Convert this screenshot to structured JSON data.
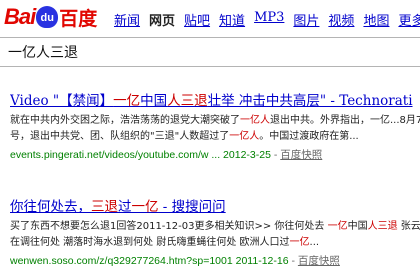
{
  "logo": {
    "text_bai": "Bai",
    "paw": "du",
    "text_cn": "百度"
  },
  "nav": [
    "新闻",
    "网页",
    "贴吧",
    "知道",
    "MP3",
    "图片",
    "视频",
    "地图",
    "更多»"
  ],
  "nav_active": "网页",
  "search": {
    "query": "一亿人三退"
  },
  "results": [
    {
      "title": [
        "Video \"【禁闻】",
        "一亿",
        "中国",
        "人三退",
        "壮举 冲击中共高层\" - Technorati"
      ],
      "snippet1": [
        "就在中共内外交困之际，浩浩荡荡的退党大潮突破了",
        "一亿人",
        "退出中共。外界指出，一亿...8月7"
      ],
      "snippet2": [
        "号，退出中共党、团、队组织的\"三退\"人数超过了",
        "一亿人",
        "。中国过渡政府在第..."
      ],
      "url": "events.pingerati.net/videos/youtube.com/w ...",
      "date": "2012-3-25",
      "cache": "百度快照"
    },
    {
      "title": [
        "你往何处去，",
        "三退",
        "过",
        "一亿",
        " - 搜搜问问"
      ],
      "snippet1": [
        "买了东西不想要怎么退1回答2011-12-03更多相关知识>> 你往何处去 ",
        "一亿",
        "中国",
        "人三退",
        " 张云川现"
      ],
      "snippet2": [
        "在调往何处 潮落时海水退到何处 尉氏嗨重蝇往何处 欧洲人口过",
        "一亿",
        "..."
      ],
      "url": "wenwen.soso.com/z/q329277264.htm?sp=1001",
      "date": "2011-12-16",
      "cache": "百度快照"
    }
  ]
}
